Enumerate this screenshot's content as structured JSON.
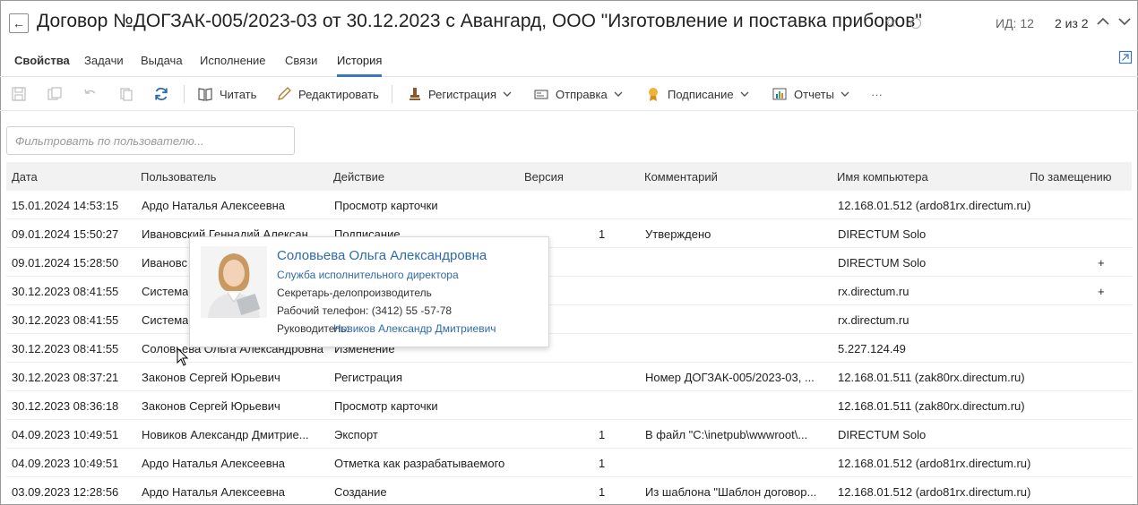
{
  "header": {
    "back_icon": "arrow-left-icon",
    "title": "Договор №ДОГЗАК-005/2023-03 от 30.12.2023 с Авангард, ООО \"Изготовление и поставка приборов\"",
    "id_label": "ИД: 12",
    "pager": "2 из 2"
  },
  "tabs": [
    {
      "label": "Свойства"
    },
    {
      "label": "Задачи"
    },
    {
      "label": "Выдача"
    },
    {
      "label": "Исполнение"
    },
    {
      "label": "Связи"
    },
    {
      "label": "История"
    }
  ],
  "active_tab": "История",
  "toolbar": {
    "read": "Читать",
    "edit": "Редактировать",
    "registration": "Регистрация",
    "send": "Отправка",
    "signing": "Подписание",
    "reports": "Отчеты",
    "more": "···"
  },
  "filter": {
    "placeholder": "Фильтровать по пользователю..."
  },
  "columns": {
    "date": "Дата",
    "user": "Пользователь",
    "action": "Действие",
    "version": "Версия",
    "comment": "Комментарий",
    "host": "Имя компьютера",
    "substitution": "По замещению"
  },
  "rows": [
    {
      "date": "15.01.2024 14:53:15",
      "user": "Ардо Наталья Алексеевна",
      "action": "Просмотр карточки",
      "version": "",
      "comment": "",
      "host": "12.168.01.512  (ardo81rx.directum.ru)",
      "sub": ""
    },
    {
      "date": "09.01.2024 15:50:27",
      "user": "Ивановский Геннадий Алексан...",
      "action": "Подписание",
      "version": "1",
      "comment": "Утверждено",
      "host": "DIRECTUM Solo",
      "sub": ""
    },
    {
      "date": "09.01.2024 15:28:50",
      "user": "Ивановс",
      "action": "",
      "version": "",
      "comment": "",
      "host": "DIRECTUM Solo",
      "sub": "+"
    },
    {
      "date": "30.12.2023 08:41:55",
      "user": "Система",
      "action": "",
      "version": "",
      "comment": "",
      "host": "rx.directum.ru",
      "sub": "+"
    },
    {
      "date": "30.12.2023 08:41:55",
      "user": "Система",
      "action": "",
      "version": "",
      "comment": "",
      "host": "rx.directum.ru",
      "sub": ""
    },
    {
      "date": "30.12.2023 08:41:55",
      "user": "Соловьева Ольга Александровна",
      "action": "Изменение",
      "version": "",
      "comment": "",
      "host": "5.227.124.49",
      "sub": ""
    },
    {
      "date": "30.12.2023 08:37:21",
      "user": "Законов Сергей Юрьевич",
      "action": "Регистрация",
      "version": "",
      "comment": "Номер ДОГЗАК-005/2023-03, ...",
      "host": "12.168.01.511  (zak80rx.directum.ru)",
      "sub": ""
    },
    {
      "date": "30.12.2023 08:36:18",
      "user": "Законов Сергей Юрьевич",
      "action": "Просмотр карточки",
      "version": "",
      "comment": "",
      "host": "12.168.01.511  (zak80rx.directum.ru)",
      "sub": ""
    },
    {
      "date": "04.09.2023 10:49:51",
      "user": "Новиков Александр Дмитрие...",
      "action": "Экспорт",
      "version": "1",
      "comment": "В файл \"C:\\inetpub\\wwwroot\\...",
      "host": "DIRECTUM Solo",
      "sub": ""
    },
    {
      "date": "04.09.2023 10:49:51",
      "user": "Ардо Наталья Алексеевна",
      "action": "Отметка как разрабатываемого",
      "version": "1",
      "comment": "",
      "host": "12.168.01.512  (ardo81rx.directum.ru)",
      "sub": ""
    },
    {
      "date": "03.09.2023 12:28:56",
      "user": "Ардо Наталья Алексеевна",
      "action": "Создание",
      "version": "1",
      "comment": "Из шаблона \"Шаблон договор...",
      "host": "12.168.01.512  (ardo81rx.directum.ru)",
      "sub": ""
    }
  ],
  "popup": {
    "name": "Соловьева Ольга Александровна",
    "department": "Служба исполнительного директора",
    "position": "Секретарь-делопроизводитель",
    "phone": "Рабочий телефон: (3412) 55 -57-78",
    "manager_label": "Руководитель:",
    "manager": "Новиков Александр Дмитриевич"
  },
  "colors": {
    "accent": "#3c78b8",
    "link": "#2f6ba8",
    "header_bg": "#f2f2f2",
    "refresh": "#2f6ba8"
  }
}
